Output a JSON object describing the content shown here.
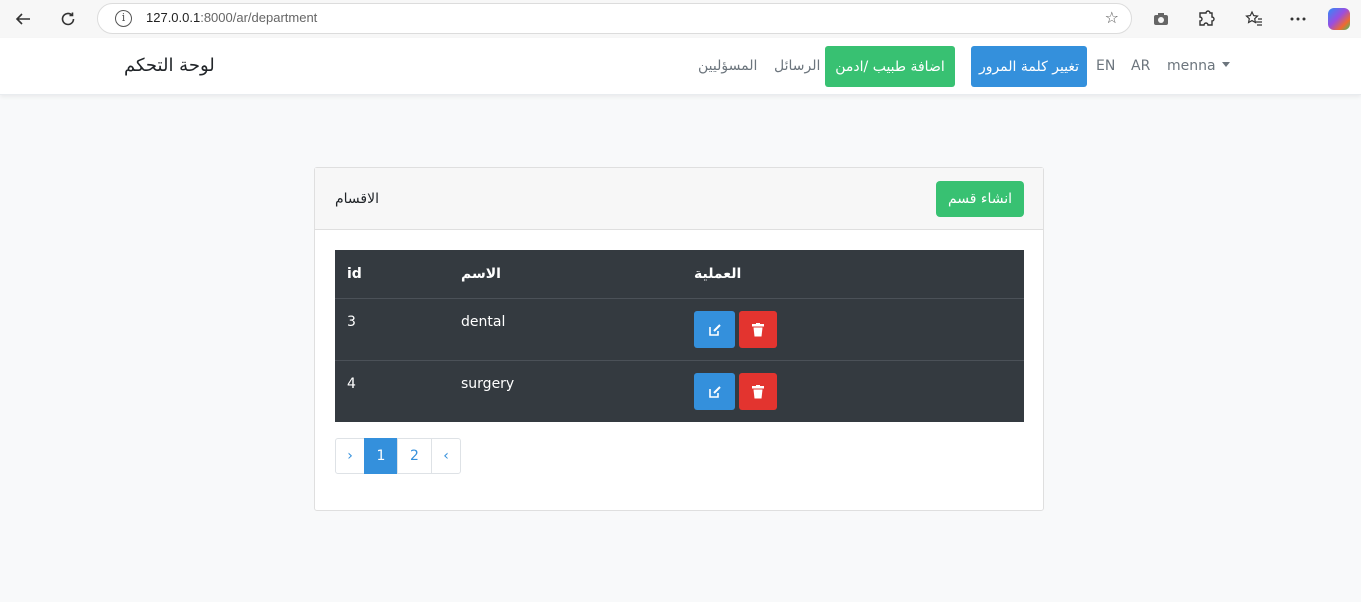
{
  "browser": {
    "url_host": "127.0.0.1",
    "url_rest": ":8000/ar/department"
  },
  "navbar": {
    "brand": "لوحة التحكم",
    "links": {
      "admins": "المسؤليين",
      "messages": "الرسائل",
      "add_doctor": "اضافة طبيب /ادمن",
      "change_password": "تغيير كلمة المرور",
      "lang_en": "EN",
      "lang_ar": "AR",
      "user": "menna"
    },
    "colors": {
      "success": "#38c172",
      "primary": "#3490dc"
    }
  },
  "card": {
    "title": "الاقسام",
    "create_button": "انشاء قسم"
  },
  "table": {
    "headers": {
      "id": "id",
      "name": "الاسم",
      "action": "العملية"
    },
    "rows": [
      {
        "id": "3",
        "name": "dental"
      },
      {
        "id": "4",
        "name": "surgery"
      }
    ]
  },
  "pagination": {
    "prev": "‹",
    "pages": [
      "1",
      "2"
    ],
    "next": "›",
    "active_page": "1"
  }
}
